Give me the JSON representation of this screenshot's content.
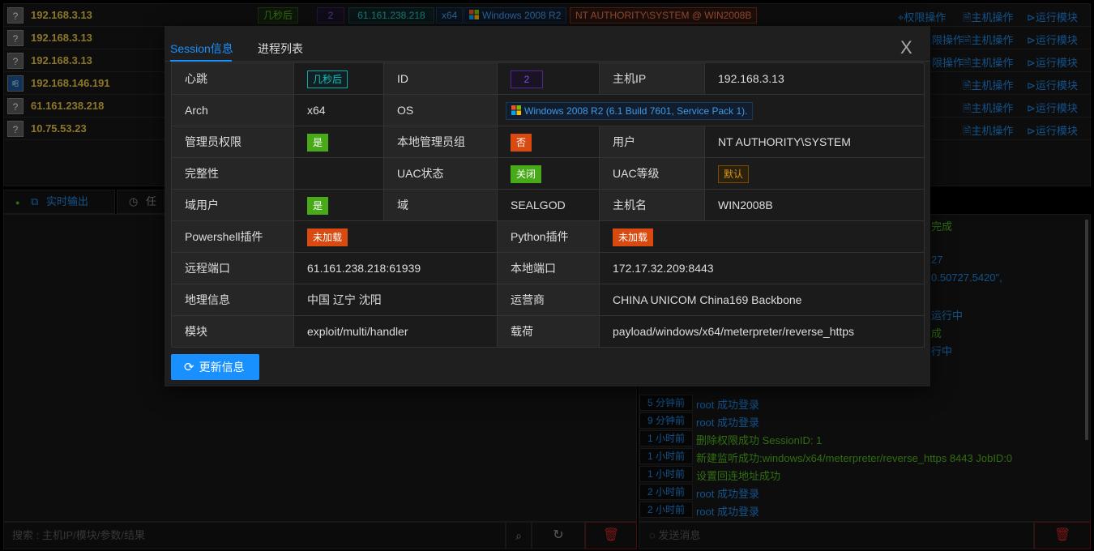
{
  "sessions": [
    {
      "ip": "192.168.3.13",
      "icon": "?",
      "tags": {
        "heartbeat": "几秒后",
        "id": "2",
        "remote_ip": "61.161.238.218",
        "arch": "x64",
        "os": "Windows 2008 R2",
        "user_host": "NT AUTHORITY\\SYSTEM @ WIN2008B"
      }
    },
    {
      "ip": "192.168.3.13",
      "icon": "?"
    },
    {
      "ip": "192.168.3.13",
      "icon": "?"
    },
    {
      "ip": "192.168.146.191",
      "icon": "昭"
    },
    {
      "ip": "61.161.238.218",
      "icon": "?"
    },
    {
      "ip": "10.75.53.23",
      "icon": "?"
    }
  ],
  "session_actions": {
    "privilege": "权限操作",
    "host": "主机操作",
    "run_module": "运行模块",
    "privilege_partial": "限操作"
  },
  "bottom_tabs": {
    "realtime": "实时输出",
    "tasks": "任"
  },
  "log_peeks": [
    "完成",
    "27",
    "0.50727.5420\",",
    "运行中",
    "成",
    "行中"
  ],
  "logs": [
    {
      "time": "5 分钟前",
      "msg": "root 成功登录",
      "color": "#1e7fd6"
    },
    {
      "time": "9 分钟前",
      "msg": "root 成功登录",
      "color": "#1e7fd6"
    },
    {
      "time": "1 小时前",
      "msg": "删除权限成功 SessionID: 1",
      "color": "#49aa19"
    },
    {
      "time": "1 小时前",
      "msg": "新建监听成功:windows/x64/meterpreter/reverse_https 8443 JobID:0",
      "color": "#49aa19"
    },
    {
      "time": "1 小时前",
      "msg": "设置回连地址成功",
      "color": "#49aa19"
    },
    {
      "time": "2 小时前",
      "msg": "root 成功登录",
      "color": "#1e7fd6"
    },
    {
      "time": "2 小时前",
      "msg": "root 成功登录",
      "color": "#1e7fd6"
    }
  ],
  "search": {
    "placeholder": "搜索 : 主机IP/模块/参数/结果"
  },
  "message": {
    "placeholder": "发送消息"
  },
  "modal": {
    "tabs": [
      "Session信息",
      "进程列表"
    ],
    "close": "X",
    "refresh_label": "更新信息",
    "fields": {
      "heartbeat_label": "心跳",
      "heartbeat": "几秒后",
      "id_label": "ID",
      "id": "2",
      "host_ip_label": "主机IP",
      "host_ip": "192.168.3.13",
      "arch_label": "Arch",
      "arch": "x64",
      "os_label": "OS",
      "os": "Windows 2008 R2 (6.1 Build 7601, Service Pack 1).",
      "admin_label": "管理员权限",
      "admin": "是",
      "local_admin_group_label": "本地管理员组",
      "local_admin_group": "否",
      "user_label": "用户",
      "user": "NT AUTHORITY\\SYSTEM",
      "integrity_label": "完整性",
      "integrity": "",
      "uac_status_label": "UAC状态",
      "uac_status": "关闭",
      "uac_level_label": "UAC等级",
      "uac_level": "默认",
      "domain_user_label": "域用户",
      "domain_user": "是",
      "domain_label": "域",
      "domain": "SEALGOD",
      "hostname_label": "主机名",
      "hostname": "WIN2008B",
      "powershell_label": "Powershell插件",
      "powershell": "未加载",
      "python_label": "Python插件",
      "python": "未加载",
      "remote_port_label": "远程端口",
      "remote_port": "61.161.238.218:61939",
      "local_port_label": "本地端口",
      "local_port": "172.17.32.209:8443",
      "geo_label": "地理信息",
      "geo": "中国 辽宁 沈阳",
      "isp_label": "运营商",
      "isp": "CHINA UNICOM China169 Backbone",
      "module_label": "模块",
      "module": "exploit/multi/handler",
      "payload_label": "载荷",
      "payload": "payload/windows/x64/meterpreter/reverse_https"
    }
  },
  "colors": {
    "accent": "#1890ff",
    "ip": "#d8b63f",
    "link": "#1e7fd6",
    "success": "#49aa19",
    "warning": "#d84a0f"
  }
}
